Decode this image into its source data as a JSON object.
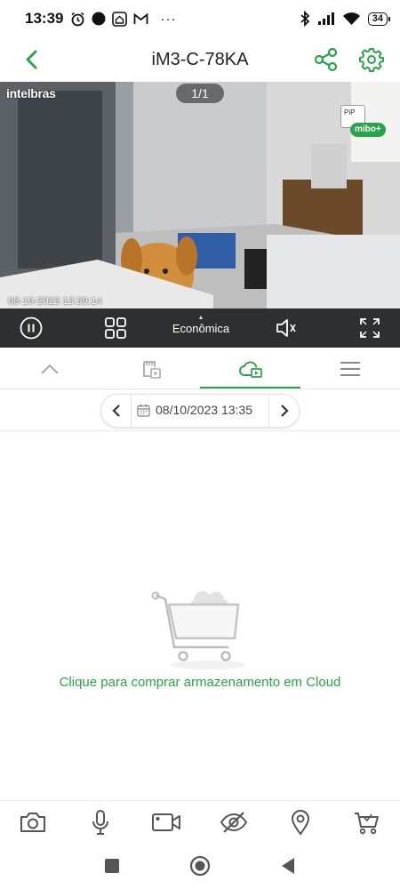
{
  "status_bar": {
    "time": "13:39",
    "battery": "34",
    "icons": [
      "alarm-icon",
      "dot-icon",
      "home-app-icon",
      "gmail-icon",
      "more-icon",
      "bluetooth-icon",
      "signal-icon",
      "wifi-icon",
      "battery-icon"
    ]
  },
  "header": {
    "title": "iM3-C-78KA",
    "accent": "#2aa448"
  },
  "video": {
    "brand": "intelbras",
    "page_counter": "1/1",
    "pip_label": "PiP",
    "mibo_label": "mibo+",
    "timestamp": "08-10-2023 13:39:14"
  },
  "controls": {
    "quality": "Econômica"
  },
  "tabs": {
    "items": [
      "collapse",
      "sd-playback",
      "cloud-playback",
      "menu"
    ],
    "active": "cloud-playback"
  },
  "date_nav": {
    "date": "08/10/2023 13:35"
  },
  "empty_state": {
    "message": "Clique para comprar armazenamento em Cloud"
  },
  "toolbar": {
    "items": [
      "camera-icon",
      "microphone-icon",
      "video-record-icon",
      "privacy-eye-icon",
      "location-pin-icon",
      "cart-icon"
    ]
  }
}
